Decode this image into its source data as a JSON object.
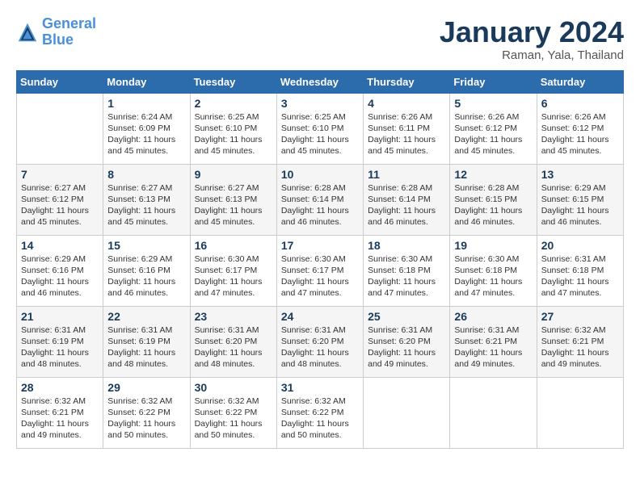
{
  "header": {
    "logo_line1": "General",
    "logo_line2": "Blue",
    "month": "January 2024",
    "location": "Raman, Yala, Thailand"
  },
  "weekdays": [
    "Sunday",
    "Monday",
    "Tuesday",
    "Wednesday",
    "Thursday",
    "Friday",
    "Saturday"
  ],
  "weeks": [
    [
      {
        "day": "",
        "info": ""
      },
      {
        "day": "1",
        "info": "Sunrise: 6:24 AM\nSunset: 6:09 PM\nDaylight: 11 hours\nand 45 minutes."
      },
      {
        "day": "2",
        "info": "Sunrise: 6:25 AM\nSunset: 6:10 PM\nDaylight: 11 hours\nand 45 minutes."
      },
      {
        "day": "3",
        "info": "Sunrise: 6:25 AM\nSunset: 6:10 PM\nDaylight: 11 hours\nand 45 minutes."
      },
      {
        "day": "4",
        "info": "Sunrise: 6:26 AM\nSunset: 6:11 PM\nDaylight: 11 hours\nand 45 minutes."
      },
      {
        "day": "5",
        "info": "Sunrise: 6:26 AM\nSunset: 6:12 PM\nDaylight: 11 hours\nand 45 minutes."
      },
      {
        "day": "6",
        "info": "Sunrise: 6:26 AM\nSunset: 6:12 PM\nDaylight: 11 hours\nand 45 minutes."
      }
    ],
    [
      {
        "day": "7",
        "info": "Sunrise: 6:27 AM\nSunset: 6:12 PM\nDaylight: 11 hours\nand 45 minutes."
      },
      {
        "day": "8",
        "info": "Sunrise: 6:27 AM\nSunset: 6:13 PM\nDaylight: 11 hours\nand 45 minutes."
      },
      {
        "day": "9",
        "info": "Sunrise: 6:27 AM\nSunset: 6:13 PM\nDaylight: 11 hours\nand 45 minutes."
      },
      {
        "day": "10",
        "info": "Sunrise: 6:28 AM\nSunset: 6:14 PM\nDaylight: 11 hours\nand 46 minutes."
      },
      {
        "day": "11",
        "info": "Sunrise: 6:28 AM\nSunset: 6:14 PM\nDaylight: 11 hours\nand 46 minutes."
      },
      {
        "day": "12",
        "info": "Sunrise: 6:28 AM\nSunset: 6:15 PM\nDaylight: 11 hours\nand 46 minutes."
      },
      {
        "day": "13",
        "info": "Sunrise: 6:29 AM\nSunset: 6:15 PM\nDaylight: 11 hours\nand 46 minutes."
      }
    ],
    [
      {
        "day": "14",
        "info": "Sunrise: 6:29 AM\nSunset: 6:16 PM\nDaylight: 11 hours\nand 46 minutes."
      },
      {
        "day": "15",
        "info": "Sunrise: 6:29 AM\nSunset: 6:16 PM\nDaylight: 11 hours\nand 46 minutes."
      },
      {
        "day": "16",
        "info": "Sunrise: 6:30 AM\nSunset: 6:17 PM\nDaylight: 11 hours\nand 47 minutes."
      },
      {
        "day": "17",
        "info": "Sunrise: 6:30 AM\nSunset: 6:17 PM\nDaylight: 11 hours\nand 47 minutes."
      },
      {
        "day": "18",
        "info": "Sunrise: 6:30 AM\nSunset: 6:18 PM\nDaylight: 11 hours\nand 47 minutes."
      },
      {
        "day": "19",
        "info": "Sunrise: 6:30 AM\nSunset: 6:18 PM\nDaylight: 11 hours\nand 47 minutes."
      },
      {
        "day": "20",
        "info": "Sunrise: 6:31 AM\nSunset: 6:18 PM\nDaylight: 11 hours\nand 47 minutes."
      }
    ],
    [
      {
        "day": "21",
        "info": "Sunrise: 6:31 AM\nSunset: 6:19 PM\nDaylight: 11 hours\nand 48 minutes."
      },
      {
        "day": "22",
        "info": "Sunrise: 6:31 AM\nSunset: 6:19 PM\nDaylight: 11 hours\nand 48 minutes."
      },
      {
        "day": "23",
        "info": "Sunrise: 6:31 AM\nSunset: 6:20 PM\nDaylight: 11 hours\nand 48 minutes."
      },
      {
        "day": "24",
        "info": "Sunrise: 6:31 AM\nSunset: 6:20 PM\nDaylight: 11 hours\nand 48 minutes."
      },
      {
        "day": "25",
        "info": "Sunrise: 6:31 AM\nSunset: 6:20 PM\nDaylight: 11 hours\nand 49 minutes."
      },
      {
        "day": "26",
        "info": "Sunrise: 6:31 AM\nSunset: 6:21 PM\nDaylight: 11 hours\nand 49 minutes."
      },
      {
        "day": "27",
        "info": "Sunrise: 6:32 AM\nSunset: 6:21 PM\nDaylight: 11 hours\nand 49 minutes."
      }
    ],
    [
      {
        "day": "28",
        "info": "Sunrise: 6:32 AM\nSunset: 6:21 PM\nDaylight: 11 hours\nand 49 minutes."
      },
      {
        "day": "29",
        "info": "Sunrise: 6:32 AM\nSunset: 6:22 PM\nDaylight: 11 hours\nand 50 minutes."
      },
      {
        "day": "30",
        "info": "Sunrise: 6:32 AM\nSunset: 6:22 PM\nDaylight: 11 hours\nand 50 minutes."
      },
      {
        "day": "31",
        "info": "Sunrise: 6:32 AM\nSunset: 6:22 PM\nDaylight: 11 hours\nand 50 minutes."
      },
      {
        "day": "",
        "info": ""
      },
      {
        "day": "",
        "info": ""
      },
      {
        "day": "",
        "info": ""
      }
    ]
  ]
}
